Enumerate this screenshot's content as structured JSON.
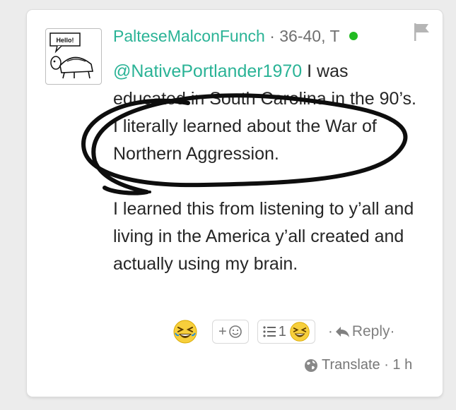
{
  "avatar": {
    "bubble_text": "Hello!"
  },
  "comment": {
    "username": "PalteseMalconFunch",
    "separator": "·",
    "meta": "36-40, T",
    "mention": "@NativePortlander1970",
    "paragraph1": " I was educated in South Carolina in the 90’s. I literally learned about the War of Northern Aggression.",
    "paragraph2": "I learned this from listening to y’all and living in the America y’all created and actually using my brain."
  },
  "actions": {
    "add_reaction_label": "+",
    "reaction_list_count": "1",
    "reply_prefix": "·",
    "reply_label": "Reply",
    "reply_suffix": "·"
  },
  "footer": {
    "translate_label": "Translate",
    "separator": " · ",
    "time_ago": "1 h"
  },
  "colors": {
    "accent": "#2ab396",
    "online": "#22bb22",
    "muted": "#777777"
  },
  "icons": [
    "flag-icon",
    "laughing-emoji-icon",
    "smiley-icon",
    "list-icon",
    "reply-arrow-icon",
    "globe-icon"
  ]
}
